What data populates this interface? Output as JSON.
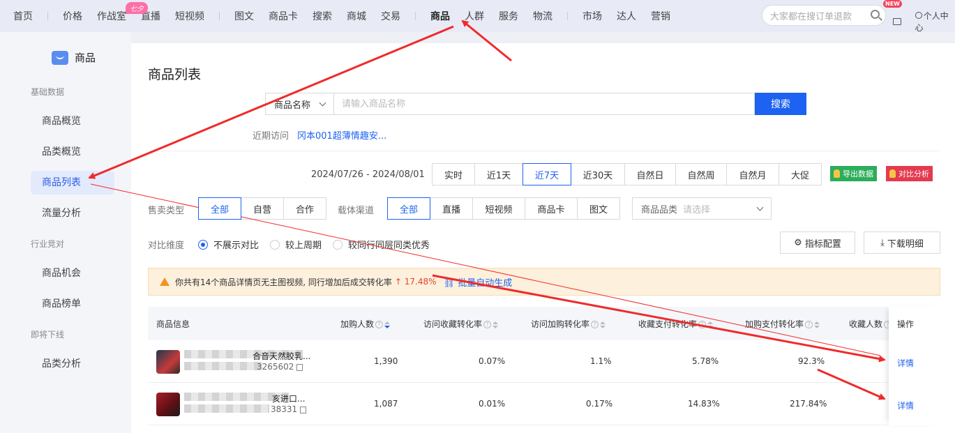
{
  "topnav": {
    "items": [
      "首页",
      "价格",
      "作战室",
      "直播",
      "短视频",
      "图文",
      "商品卡",
      "搜索",
      "商城",
      "交易",
      "商品",
      "人群",
      "服务",
      "物流",
      "市场",
      "达人",
      "营销"
    ],
    "active_index": 10,
    "promo_badge": "七夕",
    "search_placeholder": "大家都在搜订单退款",
    "new_badge": "NEW",
    "user_label": "个人中心"
  },
  "sidebar": {
    "brand": "商品",
    "groups": [
      {
        "title": "基础数据",
        "items": [
          "商品概览",
          "品类概览",
          "商品列表",
          "流量分析"
        ]
      },
      {
        "title": "行业竞对",
        "items": [
          "商品机会",
          "商品榜单"
        ]
      },
      {
        "title": "即将下线",
        "items": [
          "品类分析"
        ]
      }
    ],
    "active_item": "商品列表"
  },
  "main": {
    "title": "商品列表",
    "search": {
      "select_label": "商品名称",
      "placeholder": "请输入商品名称",
      "button": "搜索"
    },
    "recent": {
      "label": "近期访问",
      "link": "冈本001超薄情趣安..."
    },
    "date_range": "2024/07/26 - 2024/08/01",
    "period_options": [
      "实时",
      "近1天",
      "近7天",
      "近30天",
      "自然日",
      "自然周",
      "自然月",
      "大促"
    ],
    "period_active": "近7天",
    "export_button": "导出数据",
    "compare_button": "对比分析",
    "sale_type": {
      "label": "售卖类型",
      "options": [
        "全部",
        "自营",
        "合作"
      ],
      "active": "全部"
    },
    "channel": {
      "label": "载体渠道",
      "options": [
        "全部",
        "直播",
        "短视频",
        "商品卡",
        "图文"
      ],
      "active": "全部"
    },
    "category": {
      "label": "商品品类",
      "placeholder": "请选择"
    },
    "compare_dim": {
      "label": "对比维度",
      "options": [
        "不展示对比",
        "较上周期",
        "较同行同层同类优秀"
      ],
      "active": "不展示对比"
    },
    "metric_config": "指标配置",
    "download_detail": "下载明细",
    "alert": {
      "text": "你共有14个商品详情页无主图视频, 同行增加后成交转化率",
      "rate": "↑ 17.48%",
      "link": "批量自动生成"
    },
    "table": {
      "headers": [
        "商品信息",
        "加购人数",
        "访问收藏转化率",
        "访问加购转化率",
        "收藏支付转化率",
        "加购支付转化率",
        "收藏人数",
        "操作"
      ],
      "rows": [
        {
          "name": "合音天然胶乳...",
          "id": "3265602",
          "cols": [
            "1,390",
            "0.07%",
            "1.1%",
            "5.78%",
            "92.3%"
          ],
          "action": "详情"
        },
        {
          "name": "亥进口...",
          "id": "38331",
          "cols": [
            "1,087",
            "0.01%",
            "0.17%",
            "14.83%",
            "217.84%"
          ],
          "action": "详情"
        }
      ]
    }
  }
}
